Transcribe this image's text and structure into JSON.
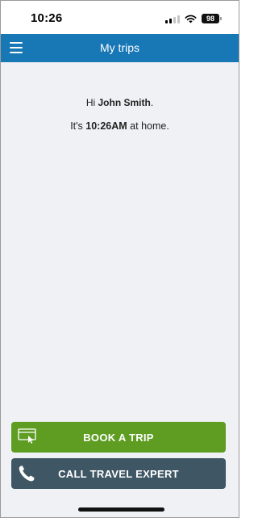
{
  "status_bar": {
    "time": "10:26",
    "battery": "98",
    "icons": [
      "signal-icon",
      "wifi-icon",
      "battery-icon"
    ]
  },
  "nav": {
    "title": "My trips",
    "menu_icon": "hamburger-menu-icon"
  },
  "greeting": {
    "prefix": "Hi",
    "name": "John Smith",
    "suffix": "."
  },
  "time_message": {
    "prefix": "It's",
    "time": "10:26AM",
    "suffix": "at home."
  },
  "buttons": {
    "book_trip": {
      "label": "BOOK A TRIP",
      "icon": "book-trip-icon"
    },
    "call_expert": {
      "label": "CALL TRAVEL EXPERT",
      "icon": "phone-icon"
    }
  },
  "colors": {
    "nav_bar": "#1877b5",
    "background": "#eff1f4",
    "book_button": "#5e9c22",
    "call_button": "#3f5764"
  }
}
